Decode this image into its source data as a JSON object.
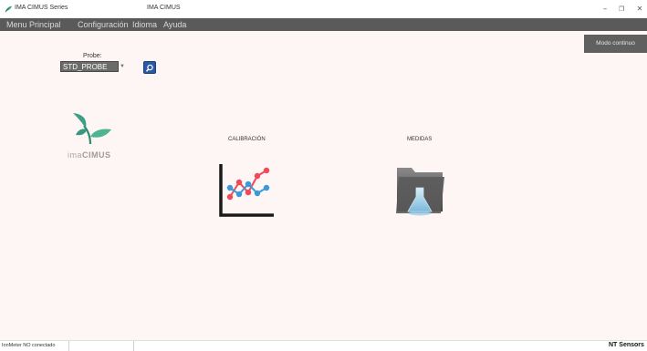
{
  "titlebar": {
    "app_title": "IMA CIMUS Series",
    "window_title": "IMA CIMUS",
    "minimize": "–",
    "maximize": "❐",
    "close": "✕"
  },
  "menu": {
    "items": [
      "Menu Principal",
      "Configuración",
      "Idioma",
      "Ayuda"
    ]
  },
  "main": {
    "modo_button": "Modo continuo",
    "probe_label": "Probe:",
    "probe_value": "STD_PROBE",
    "logo_text_light": "ima",
    "logo_text_bold": "CIMUS",
    "calibration_label": "CALIBRACIÓN",
    "medidas_label": "MEDIDAS"
  },
  "status": {
    "connection": "IonMeter NO conectado",
    "brand": "NT Sensors"
  },
  "colors": {
    "menubar": "#5a5a5a",
    "background": "#fdf6f4",
    "accent_blue": "#2a57a8",
    "logo_green": "#3f9e86"
  }
}
